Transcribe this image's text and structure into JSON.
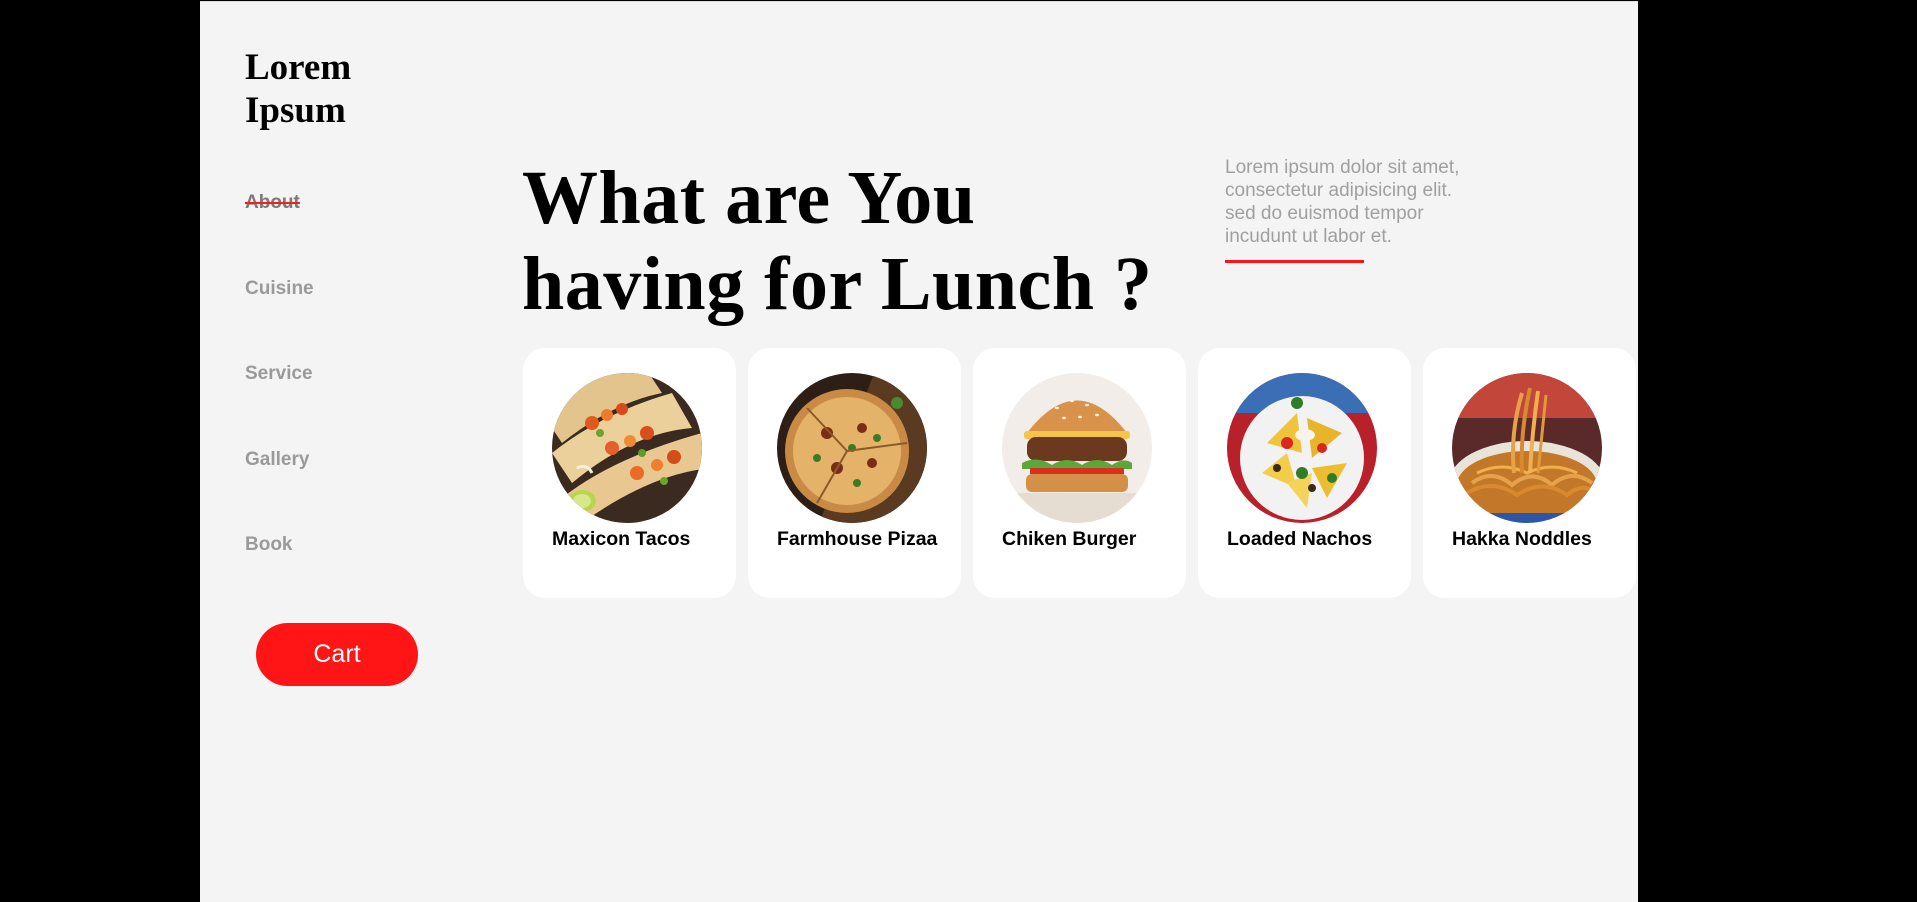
{
  "brand": {
    "line1": "Lorem",
    "line2": "Ipsum"
  },
  "nav": {
    "items": [
      {
        "label": "About",
        "active": true
      },
      {
        "label": "Cuisine",
        "active": false
      },
      {
        "label": "Service",
        "active": false
      },
      {
        "label": "Gallery",
        "active": false
      },
      {
        "label": "Book",
        "active": false
      }
    ]
  },
  "cart": {
    "label": "Cart"
  },
  "hero": {
    "line1": "What are You",
    "line2": "having for Lunch ?"
  },
  "intro": {
    "text": "Lorem ipsum dolor sit amet, consectetur adipisicing elit. sed do euismod tempor incudunt ut labor et."
  },
  "dishes": [
    {
      "name": "Maxicon Tacos",
      "icon": "tacos-image"
    },
    {
      "name": "Farmhouse Pizaa",
      "icon": "pizza-image"
    },
    {
      "name": "Chiken Burger",
      "icon": "burger-image"
    },
    {
      "name": "Loaded Nachos",
      "icon": "nachos-image"
    },
    {
      "name": "Hakka Noddles",
      "icon": "noodles-image"
    }
  ],
  "colors": {
    "accent": "#ff1515",
    "page_bg": "#f4f4f4",
    "card_bg": "#ffffff",
    "nav_text": "#9a9a9a",
    "outer_bg": "#000000"
  }
}
